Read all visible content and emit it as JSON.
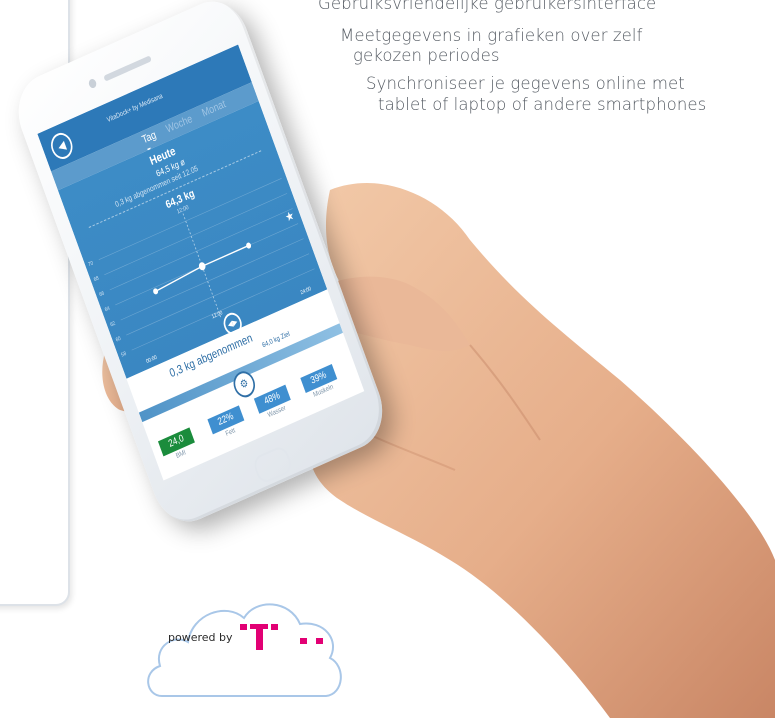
{
  "features": {
    "line0": "Gebruiksvriendelijke gebruikersinterface",
    "line1a": "Meetgegevens in grafieken over zelf",
    "line1b": "gekozen periodes",
    "line2a": "Synchroniseer je gegevens online met",
    "line2b": "tablet of laptop of andere smartphones"
  },
  "app": {
    "title": "VitaDock+ by Medisana",
    "tabs": [
      "Tag",
      "Woche",
      "Monat"
    ],
    "active_tab": "Tag",
    "header": "Heute",
    "weight_avg": "64,5 kg ø",
    "lost_since": "0,3 kg abgenommen seit 12.05",
    "current_weight": "64,3 kg",
    "current_time": "12:00",
    "y_ticks": [
      "70",
      "68",
      "66",
      "64",
      "62",
      "60",
      "58"
    ],
    "x_ticks": [
      "00:00",
      "12:00",
      "24:00"
    ],
    "result_main": "0,3 kg abgenommen",
    "result_sub": "64,0 kg Ziel",
    "metrics": [
      {
        "value": "24,0",
        "label": "BMI",
        "color": "#1b8c3c"
      },
      {
        "value": "22%",
        "label": "Fett",
        "color": "#3f8fd0"
      },
      {
        "value": "48%",
        "label": "Wasser",
        "color": "#3f8fd0"
      },
      {
        "value": "39%",
        "label": "Muskeln",
        "color": "#3f8fd0"
      }
    ]
  },
  "cloud": {
    "text": "powered by",
    "brand_color": "#e20074"
  },
  "icons": {
    "back": "back-arrow-icon",
    "settings": "gear-icon",
    "navigate": "left-right-arrows-icon"
  }
}
